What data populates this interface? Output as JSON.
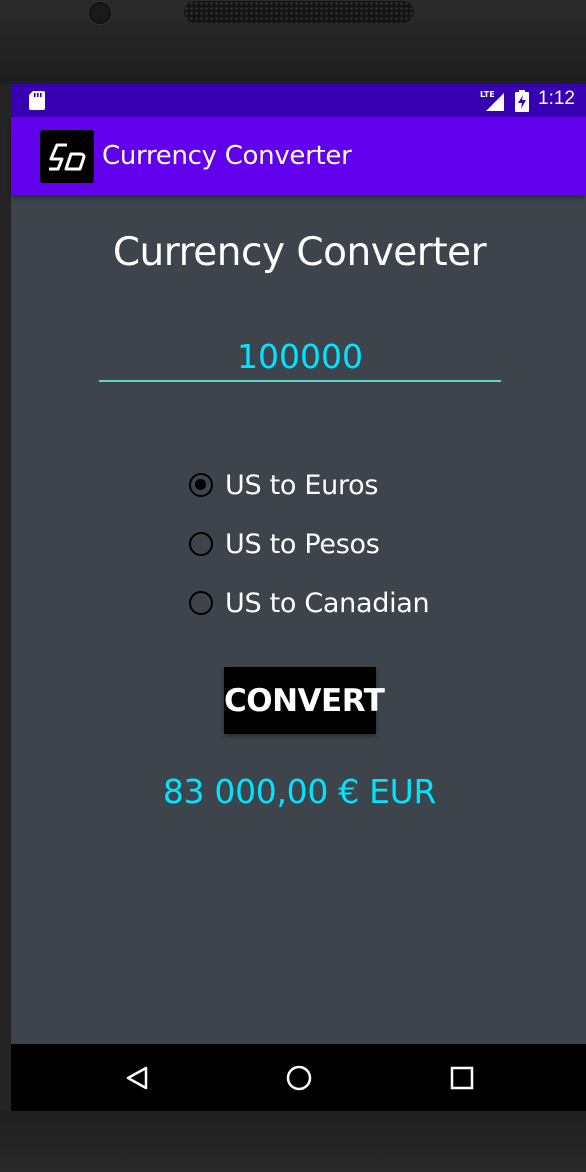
{
  "status_bar": {
    "time": "1:12",
    "icons": [
      "sd-card-icon",
      "lte-signal-icon",
      "battery-charging-icon"
    ]
  },
  "app_bar": {
    "title": "Currency Converter",
    "logo_icon": "app-logo-icon"
  },
  "main": {
    "heading": "Currency Converter",
    "amount_input": {
      "value": "100000",
      "placeholder": ""
    },
    "options": [
      {
        "label": "US to Euros",
        "checked": true
      },
      {
        "label": "US to Pesos",
        "checked": false
      },
      {
        "label": "US to Canadian",
        "checked": false
      }
    ],
    "convert_label": "CONVERT",
    "result": "83 000,00 € EUR"
  },
  "nav_bar": {
    "icons": [
      "back-icon",
      "home-icon",
      "recent-apps-icon"
    ]
  },
  "colors": {
    "status_bar": "#3700b3",
    "app_bar": "#6200ee",
    "background": "#3d444c",
    "accent_text": "#00e5ff",
    "underline": "#5fd4cb"
  }
}
